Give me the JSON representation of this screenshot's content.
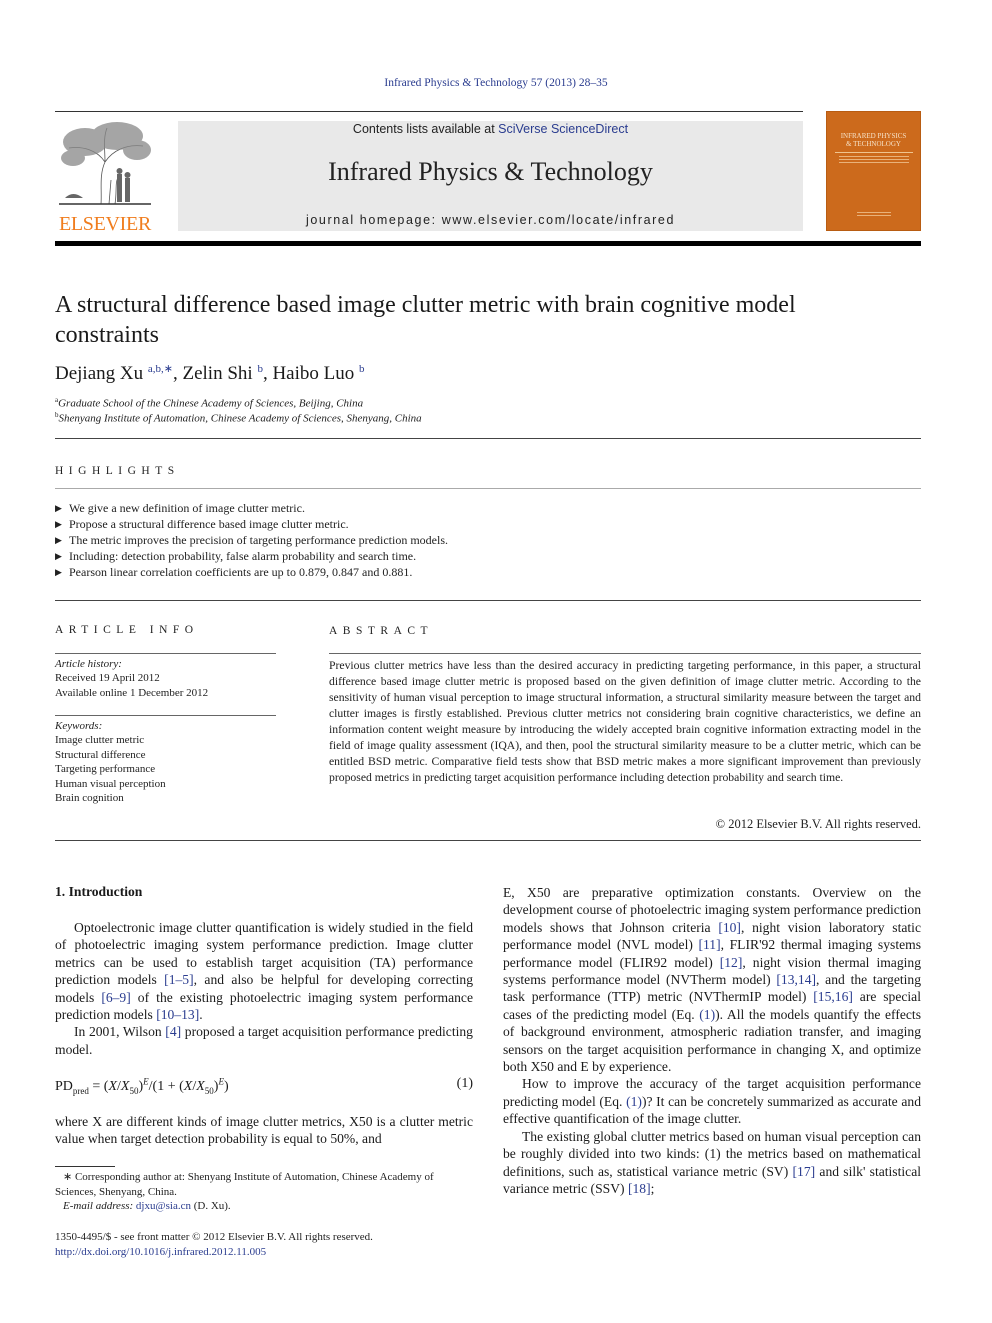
{
  "running_head": "Infrared Physics & Technology 57 (2013) 28–35",
  "header": {
    "publisher_wordmark": "ELSEVIER",
    "contents_prefix": "Contents lists available at ",
    "contents_link": "SciVerse ScienceDirect",
    "journal_title": "Infrared Physics & Technology",
    "homepage": "journal homepage: www.elsevier.com/locate/infrared",
    "cover_title_line1": "INFRARED PHYSICS",
    "cover_title_line2": "& TECHNOLOGY",
    "colors": {
      "publisher_orange": "#f07d1e",
      "cover_orange": "#cc6a1c",
      "link_blue": "#2a3c8f",
      "masthead_gray": "#e9e9e9"
    }
  },
  "article": {
    "title": "A structural difference based image clutter metric with brain cognitive model constraints",
    "authors": [
      {
        "name": "Dejiang Xu",
        "marks": "a,b,∗"
      },
      {
        "name": "Zelin Shi",
        "marks": "b"
      },
      {
        "name": "Haibo Luo",
        "marks": "b"
      }
    ],
    "author_separator": ", ",
    "affiliations": [
      {
        "mark": "a",
        "text": "Graduate School of the Chinese Academy of Sciences, Beijing, China"
      },
      {
        "mark": "b",
        "text": "Shenyang Institute of Automation, Chinese Academy of Sciences, Shenyang, China"
      }
    ]
  },
  "highlights": {
    "heading": "HIGHLIGHTS",
    "bullet": "▶",
    "items": [
      "We give a new definition of image clutter metric.",
      "Propose a structural difference based image clutter metric.",
      "The metric improves the precision of targeting performance prediction models.",
      "Including: detection probability, false alarm probability and search time.",
      "Pearson linear correlation coefficients are up to 0.879, 0.847 and 0.881."
    ]
  },
  "article_info": {
    "heading": "ARTICLE INFO",
    "history_label": "Article history:",
    "received": "Received 19 April 2012",
    "available": "Available online 1 December 2012",
    "keywords_label": "Keywords:",
    "keywords": [
      "Image clutter metric",
      "Structural difference",
      "Targeting performance",
      "Human visual perception",
      "Brain cognition"
    ]
  },
  "abstract": {
    "heading": "ABSTRACT",
    "text": "Previous clutter metrics have less than the desired accuracy in predicting targeting performance, in this paper, a structural difference based image clutter metric is proposed based on the given definition of image clutter metric. According to the sensitivity of human visual perception to image structural information, a structural similarity measure between the target and clutter images is firstly established. Previous clutter metrics not considering brain cognitive characteristics, we define an information content weight measure by introducing the widely accepted brain cognitive information extracting model in the field of image quality assessment (IQA), and then, pool the structural similarity measure to be a clutter metric, which can be entitled BSD metric. Comparative field tests show that BSD metric makes a more significant improvement than previously proposed metrics in predicting target acquisition performance including detection probability and search time.",
    "copyright": "© 2012 Elsevier B.V. All rights reserved."
  },
  "body": {
    "section_heading": "1. Introduction",
    "left": {
      "p1": [
        {
          "t": "Optoelectronic image clutter quantification is widely studied in the field of photoelectric imaging system performance prediction. Image clutter metrics can be used to establish target acquisition (TA) performance prediction models "
        },
        {
          "ref": "[1–5]"
        },
        {
          "t": ", and also be helpful for developing correcting models "
        },
        {
          "ref": "[6–9]"
        },
        {
          "t": " of the existing photoelectric imaging system performance prediction models "
        },
        {
          "ref": "[10–13]"
        },
        {
          "t": "."
        }
      ],
      "p2": [
        {
          "t": "In 2001, Wilson "
        },
        {
          "ref": "[4]"
        },
        {
          "t": " proposed a target acquisition performance predicting model."
        }
      ],
      "equation": {
        "lhs": "PD",
        "lhs_sub": "pred",
        "x": "X",
        "x50_sub": "50",
        "exp": "E",
        "number": "(1)"
      },
      "p3": "where X are different kinds of image clutter metrics, X50 is a clutter metric value when target detection probability is equal to 50%, and"
    },
    "right": {
      "p1": [
        {
          "t": "E, X50 are preparative optimization constants. Overview on the development course of photoelectric imaging system performance prediction models shows that Johnson criteria "
        },
        {
          "ref": "[10]"
        },
        {
          "t": ", night vision laboratory static performance model (NVL model) "
        },
        {
          "ref": "[11]"
        },
        {
          "t": ", FLIR'92 thermal imaging systems performance model (FLIR92 model) "
        },
        {
          "ref": "[12]"
        },
        {
          "t": ", night vision thermal imaging systems performance model (NVTherm model) "
        },
        {
          "ref": "[13,14]"
        },
        {
          "t": ", and the targeting task performance (TTP) metric (NVThermIP model) "
        },
        {
          "ref": "[15,16]"
        },
        {
          "t": " are special cases of the predicting model (Eq. "
        },
        {
          "ref": "(1)"
        },
        {
          "t": "). All the models quantify the effects of background environment, atmospheric radiation transfer, and imaging sensors on the target acquisition performance in changing X, and optimize both X50 and E by experience."
        }
      ],
      "p2": [
        {
          "t": "How to improve the accuracy of the target acquisition performance predicting model (Eq. "
        },
        {
          "ref": "(1)"
        },
        {
          "t": ")? It can be concretely summarized as accurate and effective quantification of the image clutter."
        }
      ],
      "p3": [
        {
          "t": "The existing global clutter metrics based on human visual perception can be roughly divided into two kinds: (1) the metrics based on mathematical definitions, such as, statistical variance metric (SV) "
        },
        {
          "ref": "[17]"
        },
        {
          "t": " and silk' statistical variance metric (SSV) "
        },
        {
          "ref": "[18]"
        },
        {
          "t": ";"
        }
      ]
    }
  },
  "footnotes": {
    "corresponding": "∗ Corresponding author at: Shenyang Institute of Automation, Chinese Academy of Sciences, Shenyang, China.",
    "email_label": "E-mail address:",
    "email": "djxu@sia.cn",
    "email_suffix": " (D. Xu).",
    "front_matter": "1350-4495/$ - see front matter © 2012 Elsevier B.V. All rights reserved.",
    "doi": "http://dx.doi.org/10.1016/j.infrared.2012.11.005"
  }
}
